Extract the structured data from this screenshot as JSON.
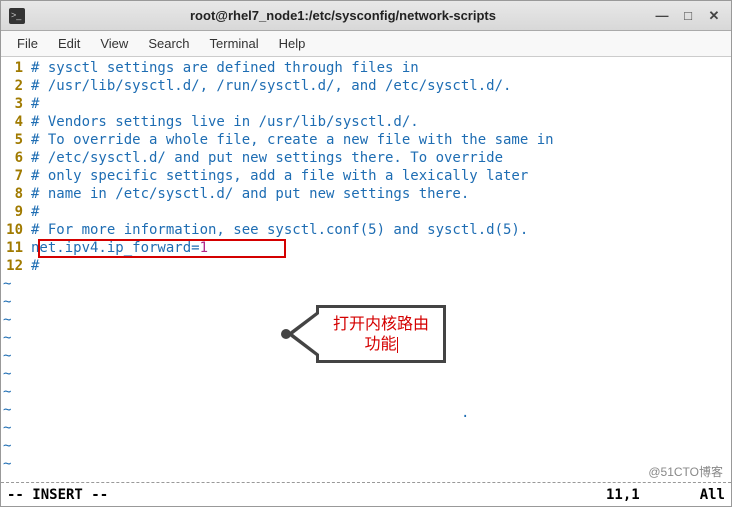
{
  "window": {
    "title": "root@rhel7_node1:/etc/sysconfig/network-scripts",
    "controls": {
      "minimize": "—",
      "maximize": "□",
      "close": "✕"
    }
  },
  "menu": {
    "file": "File",
    "edit": "Edit",
    "view": "View",
    "search": "Search",
    "terminal": "Terminal",
    "help": "Help"
  },
  "code": {
    "lines": [
      {
        "n": "1",
        "comment": "# sysctl settings are defined through files in"
      },
      {
        "n": "2",
        "comment": "# /usr/lib/sysctl.d/, /run/sysctl.d/, and /etc/sysctl.d/."
      },
      {
        "n": "3",
        "comment": "#"
      },
      {
        "n": "4",
        "comment": "# Vendors settings live in /usr/lib/sysctl.d/."
      },
      {
        "n": "5",
        "comment": "# To override a whole file, create a new file with the same in"
      },
      {
        "n": "6",
        "comment": "# /etc/sysctl.d/ and put new settings there. To override"
      },
      {
        "n": "7",
        "comment": "# only specific settings, add a file with a lexically later"
      },
      {
        "n": "8",
        "comment": "# name in /etc/sysctl.d/ and put new settings there."
      },
      {
        "n": "9",
        "comment": "#"
      },
      {
        "n": "10",
        "comment": "# For more information, see sysctl.conf(5) and sysctl.d(5)."
      },
      {
        "n": "11",
        "key": "net.ipv4.ip_forward",
        "eq": "=",
        "val": "1"
      },
      {
        "n": "12",
        "comment": "#"
      }
    ],
    "tilde": "~"
  },
  "annotation": {
    "line1": "打开内核路由",
    "line2": "功能"
  },
  "status": {
    "mode": "-- INSERT --",
    "position": "11,1",
    "scroll": "All"
  },
  "watermark": "@51CTO博客"
}
